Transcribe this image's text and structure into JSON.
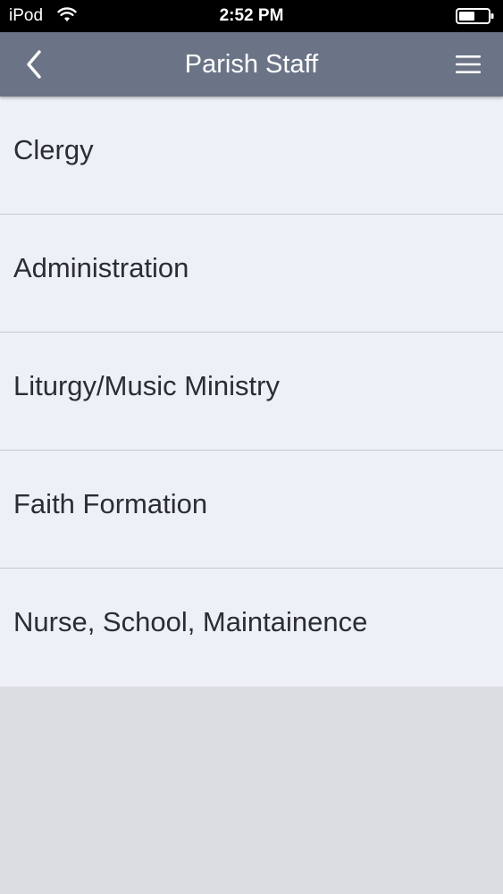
{
  "status_bar": {
    "carrier": "iPod",
    "time": "2:52 PM",
    "wifi_icon": "wifi-icon",
    "battery_icon": "battery-icon"
  },
  "nav": {
    "title": "Parish Staff",
    "back_icon": "chevron-left-icon",
    "menu_icon": "hamburger-menu-icon",
    "background_color": "#6b7486"
  },
  "list": {
    "items": [
      {
        "label": "Clergy"
      },
      {
        "label": "Administration"
      },
      {
        "label": "Liturgy/Music Ministry"
      },
      {
        "label": "Faith Formation"
      },
      {
        "label": "Nurse, School, Maintainence"
      }
    ],
    "item_background": "#edf0f6"
  }
}
